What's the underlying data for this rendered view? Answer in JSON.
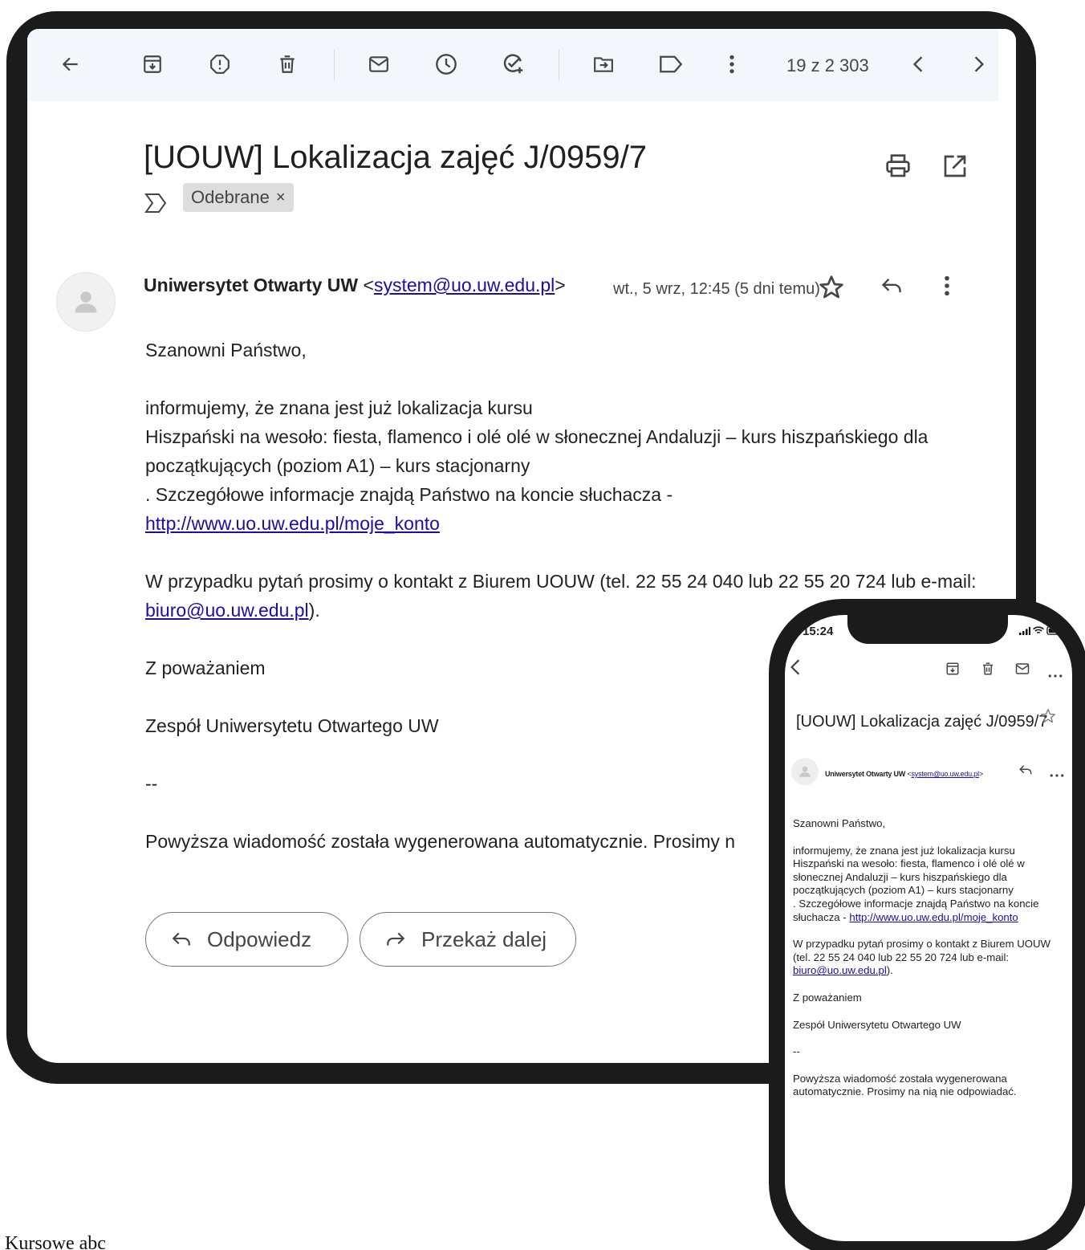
{
  "toolbar": {
    "icons": [
      "back-arrow-icon",
      "archive-icon",
      "report-spam-icon",
      "delete-icon",
      "mark-unread-icon",
      "snooze-icon",
      "add-task-icon",
      "move-to-icon",
      "label-icon",
      "more-vert-icon",
      "prev-icon",
      "next-icon"
    ],
    "count": "19 z 2 303"
  },
  "email": {
    "subject": "[UOUW] Lokalizacja zajęć J/0959/7",
    "label": "Odebrane",
    "label_close": "×",
    "sender_name": "Uniwersytet Otwarty UW",
    "sender_open": "<",
    "sender_email": "system@uo.uw.edu.pl",
    "sender_close": ">",
    "date": "wt., 5 wrz, 12:45 (5 dni temu)",
    "greeting": "Szanowni Państwo,",
    "line1": "informujemy, że znana jest już lokalizacja kursu",
    "line2": "Hiszpański na wesoło: fiesta, flamenco i olé olé w słonecznej Andaluzji – kurs hiszpańskiego dla początkujących (poziom A1) – kurs stacjonarny",
    "line3": ". Szczegółowe informacje znajdą Państwo na koncie słuchacza -",
    "account_link": "http://www.uo.uw.edu.pl/moje_konto",
    "contact_text": "W przypadku pytań prosimy o kontakt z  Biurem UOUW (tel. 22 55 24 040 lub 22 55 20 724 lub e-mail: ",
    "contact_email": "biuro@uo.uw.edu.pl",
    "contact_end": ").",
    "regards": "Z poważaniem",
    "team": "Zespół Uniwersytetu Otwartego UW",
    "dashes": "--",
    "auto_note_visible": "Powyższa wiadomość została wygenerowana automatycznie. Prosimy n",
    "auto_note_full": "Powyższa wiadomość została wygenerowana automatycznie. Prosimy na nią nie odpowiadać."
  },
  "actions": {
    "reply": "Odpowiedz",
    "forward": "Przekaż dalej"
  },
  "phone": {
    "time": "15:24",
    "sender_short": "Uniwersytet Otwarty UW",
    "phone_line3": ". Szczegółowe informacje znajdą Państwo na koncie słuchacza - ",
    "phone_contact_text": "W przypadku pytań prosimy o kontakt z  Biurem UOUW (tel. 22 55 24 040 lub 22 55 20 724 lub e-mail: "
  },
  "caption": "Kursowe abc"
}
